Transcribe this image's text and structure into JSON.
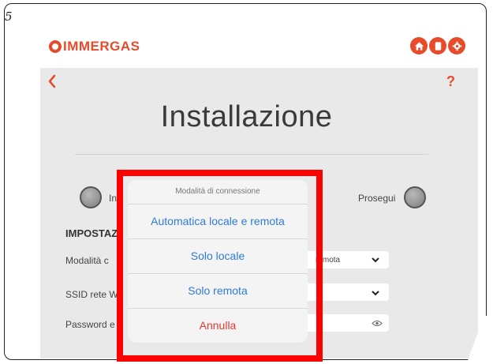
{
  "step_number": "5",
  "header": {
    "brand": "IMMERGAS",
    "icons": [
      "home-icon",
      "manual-icon",
      "settings-icon"
    ]
  },
  "page": {
    "title": "Installazione",
    "help_label": "?"
  },
  "navigation": {
    "back_label": "Indietro",
    "back_label_visible": "In",
    "next_label": "Prosegui"
  },
  "settings": {
    "heading_visible": "IMPOSTAZ",
    "fields": [
      {
        "label_visible": "Modalità c",
        "value_visible": "remota",
        "control": "dropdown"
      },
      {
        "label_visible": "SSID rete W",
        "value_visible": "",
        "control": "dropdown"
      },
      {
        "label_visible": "Password e",
        "value_visible": "",
        "control": "password"
      }
    ]
  },
  "action_sheet": {
    "title": "Modalità di connessione",
    "options": [
      "Automatica locale e remota",
      "Solo locale",
      "Solo remota"
    ],
    "cancel": "Annulla"
  },
  "colors": {
    "brand": "#e84b2a",
    "link": "#2f7bd6",
    "cancel": "#e53935",
    "highlight": "#ff0000",
    "app_background": "#e9e9e9"
  }
}
